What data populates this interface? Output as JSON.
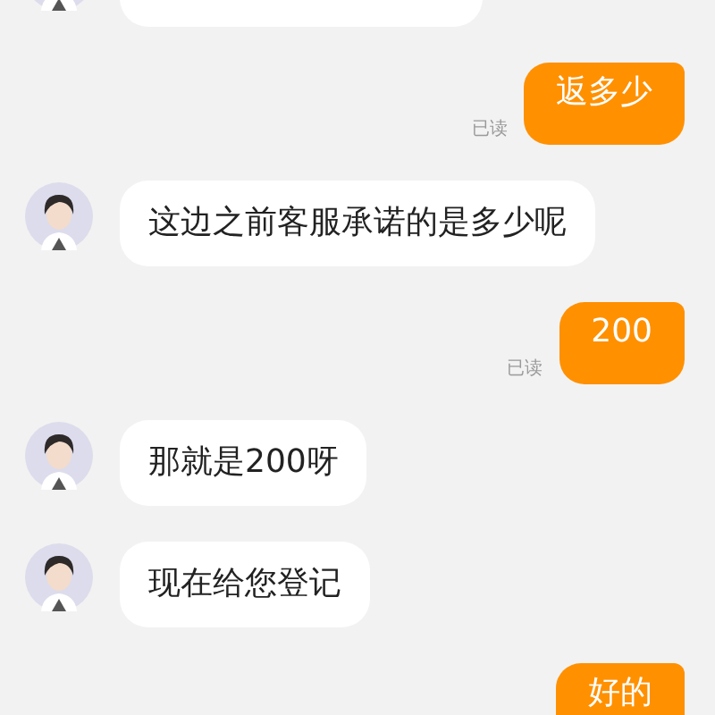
{
  "messages": [
    {
      "kind": "agent"
    },
    {
      "kind": "user",
      "text": "返多少",
      "read_label": "已读"
    },
    {
      "kind": "agent",
      "text": "这边之前客服承诺的是多少呢"
    },
    {
      "kind": "user",
      "text": "200",
      "read_label": "已读"
    },
    {
      "kind": "agent",
      "text": "那就是200呀"
    },
    {
      "kind": "agent",
      "text": "现在给您登记"
    },
    {
      "kind": "user",
      "text": "好的"
    }
  ]
}
